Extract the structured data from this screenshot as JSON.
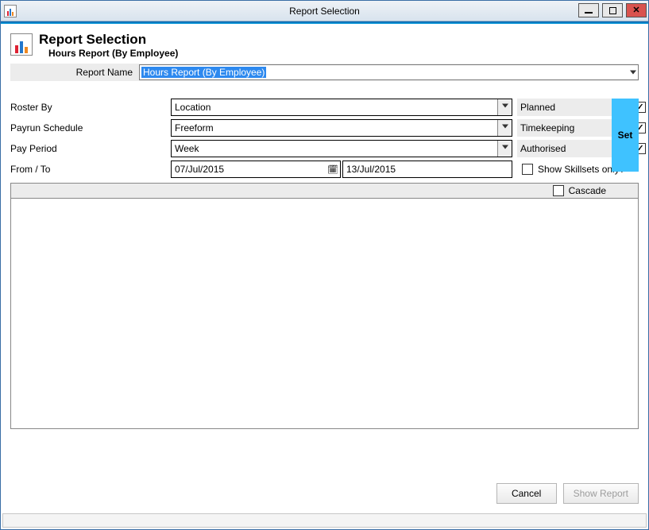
{
  "window": {
    "title": "Report Selection"
  },
  "header": {
    "title": "Report Selection",
    "subtitle": "Hours Report (By Employee)"
  },
  "reportName": {
    "label": "Report Name",
    "value": "Hours Report (By Employee)"
  },
  "filters": {
    "rosterBy": {
      "label": "Roster By",
      "value": "Location"
    },
    "payrunSchedule": {
      "label": "Payrun Schedule",
      "value": "Freeform"
    },
    "payPeriod": {
      "label": "Pay Period",
      "value": "Week"
    },
    "fromTo": {
      "label": "From / To",
      "from": "07/Jul/2015",
      "to": "13/Jul/2015"
    }
  },
  "checks": {
    "planned": {
      "label": "Planned",
      "checked": true
    },
    "timekeeping": {
      "label": "Timekeeping",
      "checked": true
    },
    "authorised": {
      "label": "Authorised",
      "checked": true
    },
    "skillsets": {
      "label": "Show Skillsets only?",
      "checked": false
    },
    "cascade": {
      "label": "Cascade",
      "checked": false
    }
  },
  "buttons": {
    "set": "Set",
    "cancel": "Cancel",
    "showReport": "Show Report"
  }
}
